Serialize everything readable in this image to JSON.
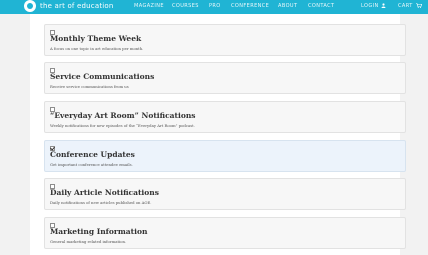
{
  "header": {
    "brand": "the art of education",
    "nav": [
      "MAGAZINE",
      "COURSES",
      "PRO",
      "CONFERENCE",
      "ABOUT",
      "CONTACT"
    ],
    "login": "LOGIN",
    "cart": "CART"
  },
  "subscriptions": [
    {
      "title": "Monthly Theme Week",
      "description": "A focus on one topic in art education per month.",
      "checked": false
    },
    {
      "title": "Service Communications",
      "description": "Receive service communications from us",
      "checked": false
    },
    {
      "title": "“Everyday Art Room” Notifications",
      "description": "Weekly notifications for new episodes of the “Everyday Art Room” podcast.",
      "checked": false
    },
    {
      "title": "Conference Updates",
      "description": "Get important conference attendee emails.",
      "checked": true
    },
    {
      "title": "Daily Article Notifications",
      "description": "Daily notifications of new articles published on AOE.",
      "checked": false
    },
    {
      "title": "Marketing Information",
      "description": "General marketing related information.",
      "checked": false
    }
  ],
  "colors": {
    "accent": "#20b4d4",
    "card": "#f7f7f7",
    "card_checked": "#ecf3fb"
  }
}
